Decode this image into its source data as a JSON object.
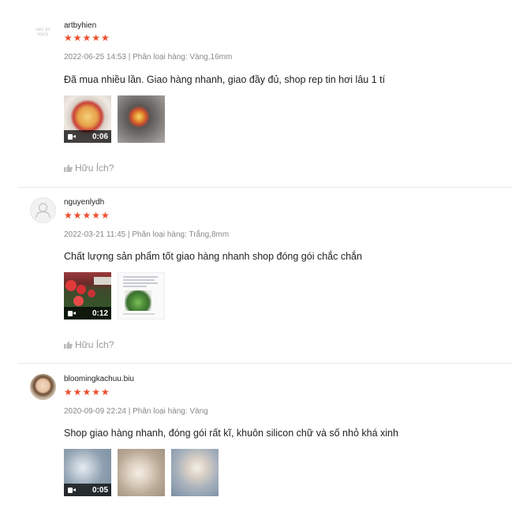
{
  "reviews": [
    {
      "username": "artbyhien",
      "stars": "★★★★★",
      "meta": "2022-06-25 14:53 | Phân loại hàng: Vàng,16mm",
      "comment": "Đã mua nhiều lần. Giao hàng nhanh, giao đầy đủ, shop rep tin hơi lâu 1 tí",
      "video_duration": "0:06",
      "helpful_label": "Hữu Ích?"
    },
    {
      "username": "nguyenlydh",
      "stars": "★★★★★",
      "meta": "2022-03-21 11:45 | Phân loại hàng: Trắng,8mm",
      "comment": "Chất lượng sản phẩm tốt giao hàng nhanh shop đóng gói chắc chắn",
      "video_duration": "0:12",
      "helpful_label": "Hữu Ích?"
    },
    {
      "username": "bloomingkachuu.biu",
      "stars": "★★★★★",
      "meta": "2020-09-09 22:24 | Phân loại hàng: Vàng",
      "comment": "Shop giao hàng nhanh, đóng gói rất kĩ, khuôn silicon chữ và số nhỏ khá xinh",
      "video_duration": "0:05"
    }
  ],
  "colors": {
    "star": "#ee4d2d",
    "meta": "#888888",
    "divider": "#e8e8e8"
  }
}
